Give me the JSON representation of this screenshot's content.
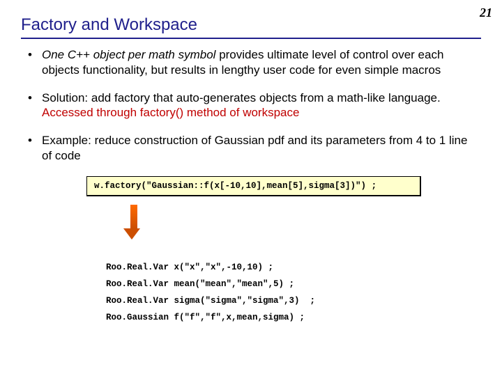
{
  "page_number": "21",
  "title": "Factory and Workspace",
  "bullets": {
    "b1_emph": "One C++ object per math symbol",
    "b1_rest": " provides ultimate level of control over each objects functionality, but results in lengthy user code for even simple macros",
    "b2_lead": "Solution: add factory that auto-generates objects from a math-like language. ",
    "b2_red": "Accessed through factory() method of workspace",
    "b3": "Example: reduce construction of Gaussian pdf and its parameters from 4 to 1 line of code"
  },
  "code_panel": "w.factory(\"Gaussian::f(x[-10,10],mean[5],sigma[3])\") ;",
  "expanded": {
    "l1": "Roo.Real.Var x(\"x\",\"x\",-10,10) ;",
    "l2": "Roo.Real.Var mean(\"mean\",\"mean\",5) ;",
    "l3": "Roo.Real.Var sigma(\"sigma\",\"sigma\",3)  ;",
    "l4": "Roo.Gaussian f(\"f\",\"f\",x,mean,sigma) ;"
  }
}
